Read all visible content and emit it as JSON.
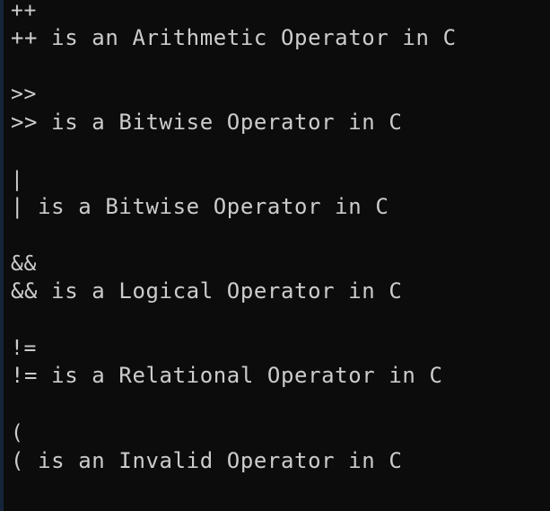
{
  "console": {
    "blocks": [
      {
        "input": "++",
        "output": "++ is an Arithmetic Operator in C"
      },
      {
        "input": ">>",
        "output": ">> is a Bitwise Operator in C"
      },
      {
        "input": "|",
        "output": "| is a Bitwise Operator in C"
      },
      {
        "input": "&&",
        "output": "&& is a Logical Operator in C"
      },
      {
        "input": "!=",
        "output": "!= is a Relational Operator in C"
      },
      {
        "input": "(",
        "output": "( is an Invalid Operator in C"
      }
    ]
  }
}
